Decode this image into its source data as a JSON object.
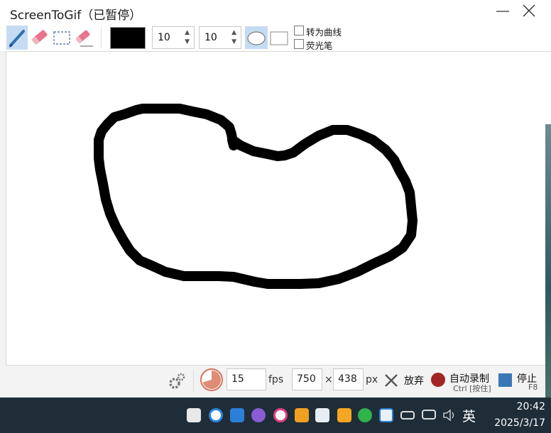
{
  "window": {
    "title": "ScreenToGif（已暂停）"
  },
  "toolbar": {
    "tools": [
      {
        "name": "pen-tool",
        "active": true
      },
      {
        "name": "highlighter-eraser-tool",
        "active": false
      },
      {
        "name": "selection-tool",
        "active": false
      },
      {
        "name": "eraser-tool",
        "active": false
      }
    ],
    "color": "#000000",
    "width_value": "10",
    "height_value": "10",
    "checkbox_curve": "转为曲线",
    "checkbox_highlighter": "荧光笔"
  },
  "status": {
    "fps_value": "15",
    "fps_unit": "fps",
    "width_value": "750",
    "times": "×",
    "height_value": "438",
    "px_unit": "px",
    "discard_label": "放弃",
    "record_label": "自动录制",
    "record_hint": "Ctrl [按住]",
    "stop_label": "停止",
    "stop_hint": "F8"
  },
  "colors": {
    "accent": "#c5dbf2",
    "record": "#a32424",
    "stop": "#3a78b5",
    "pen": "#2f6fb3"
  },
  "taskbar": {
    "ime": "英",
    "time": "20:42",
    "date": "2025/3/17"
  }
}
